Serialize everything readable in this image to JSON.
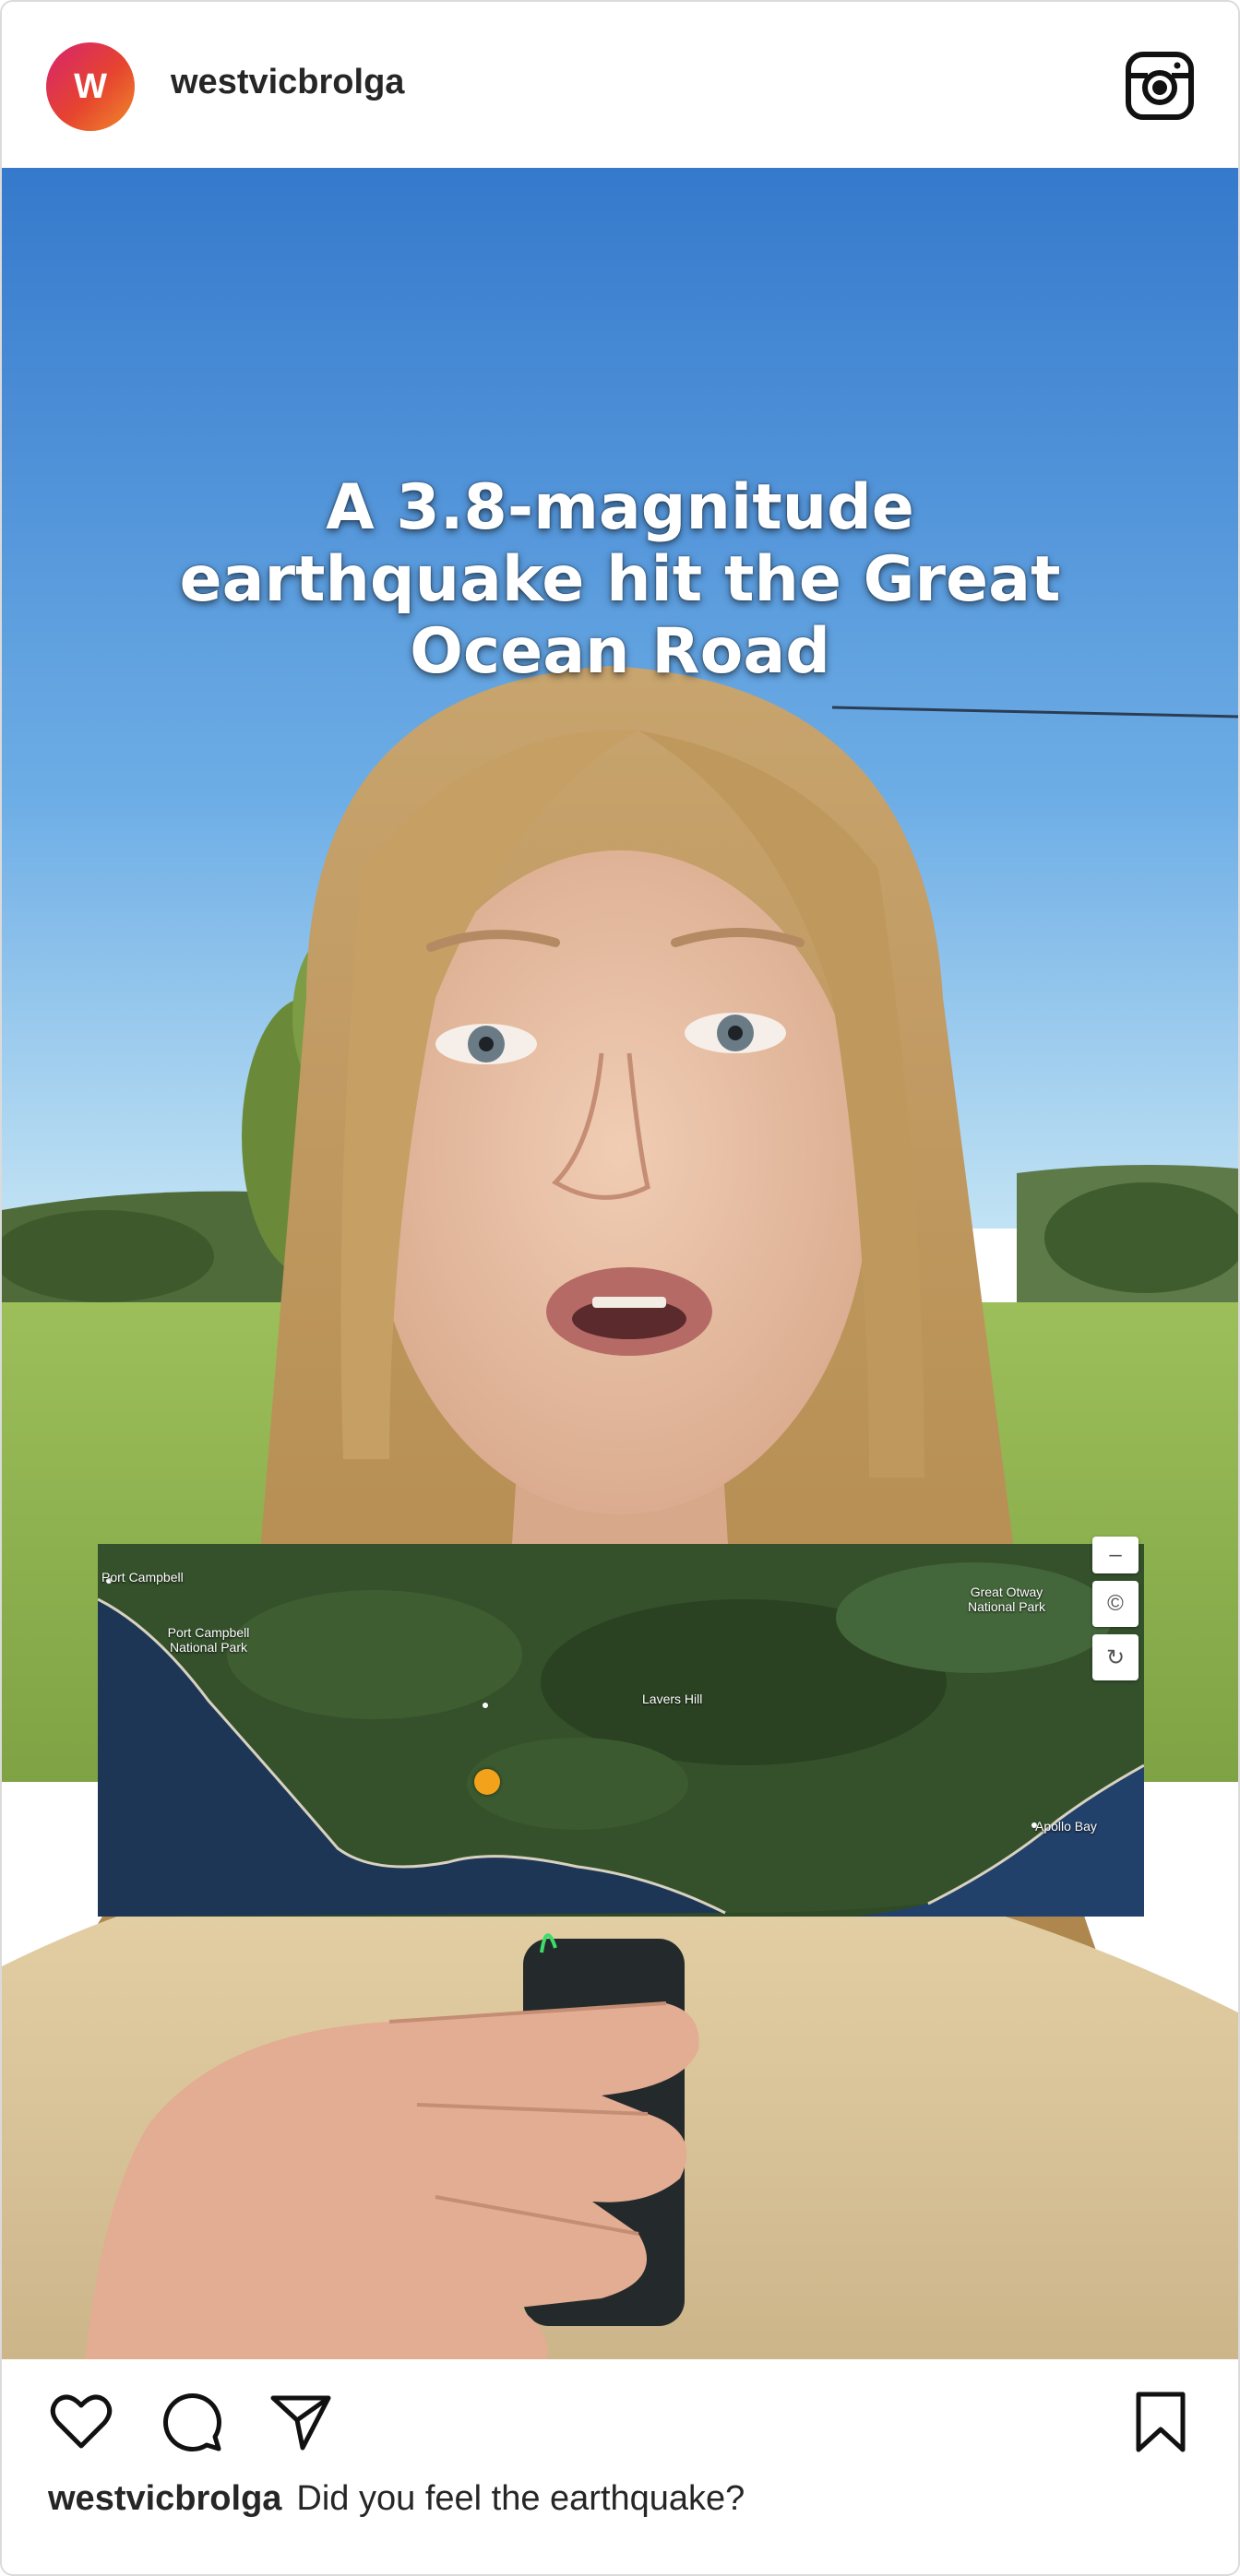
{
  "header": {
    "avatar_letter": "W",
    "username": "westvicbrolga",
    "instagram_icon": "instagram-logo-icon"
  },
  "video": {
    "overlay_text": "A 3.8-magnitude earthquake hit the Great Ocean Road"
  },
  "map": {
    "labels": {
      "port_campbell": "Port Campbell",
      "port_campbell_np": "Port Campbell National Park",
      "great_otway_np": "Great Otway National Park",
      "lavers_hill": "Lavers Hill",
      "apollo_bay": "Apollo Bay"
    },
    "controls": {
      "zoom_out": "–",
      "copyright": "©",
      "reset": "↻"
    },
    "marker_color": "#f2a31b"
  },
  "actions": {
    "like_icon": "heart-icon",
    "comment_icon": "comment-icon",
    "share_icon": "paper-plane-icon",
    "save_icon": "bookmark-icon"
  },
  "post": {
    "caption_username": "westvicbrolga",
    "caption_text": "Did you feel the earthquake?"
  },
  "colors": {
    "sky_top": "#3a7fd0",
    "sky_bottom": "#bfe0f2",
    "grass": "#8ab04c",
    "text_dark": "#262626"
  }
}
